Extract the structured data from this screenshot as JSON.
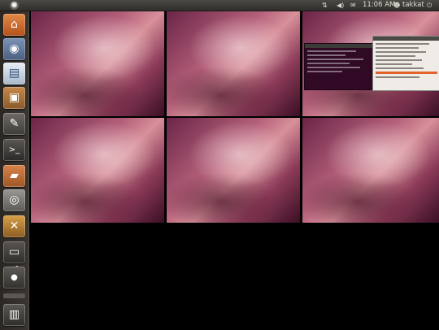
{
  "panel": {
    "clock": "11:06 AM",
    "user": "takkat",
    "icons": {
      "menu": "ubuntu-logo-icon",
      "network": "network-arrows-icon",
      "volume": "volume-icon",
      "mail": "envelope-icon",
      "user": "user-icon",
      "power": "power-icon"
    }
  },
  "launcher": {
    "items": [
      {
        "icon": "home-folder-icon",
        "glyph": "⌂"
      },
      {
        "icon": "firefox-icon",
        "glyph": "◉"
      },
      {
        "icon": "writer-document-icon",
        "glyph": "▤"
      },
      {
        "icon": "software-center-icon",
        "glyph": "▣"
      },
      {
        "icon": "text-editor-icon",
        "glyph": "✎"
      },
      {
        "icon": "terminal-icon",
        "glyph": ">_"
      },
      {
        "icon": "files-folder-icon",
        "glyph": "▰"
      },
      {
        "icon": "disk-utility-icon",
        "glyph": "◎"
      },
      {
        "icon": "system-settings-icon",
        "glyph": "✕"
      },
      {
        "icon": "workspace-switcher-icon",
        "glyph": "▭"
      },
      {
        "icon": "dvd-drive-icon",
        "glyph": "●"
      },
      {
        "icon": "trash-icon",
        "glyph": "▥"
      }
    ]
  },
  "workspaces": {
    "count": 6,
    "active_windows_in": 3
  }
}
